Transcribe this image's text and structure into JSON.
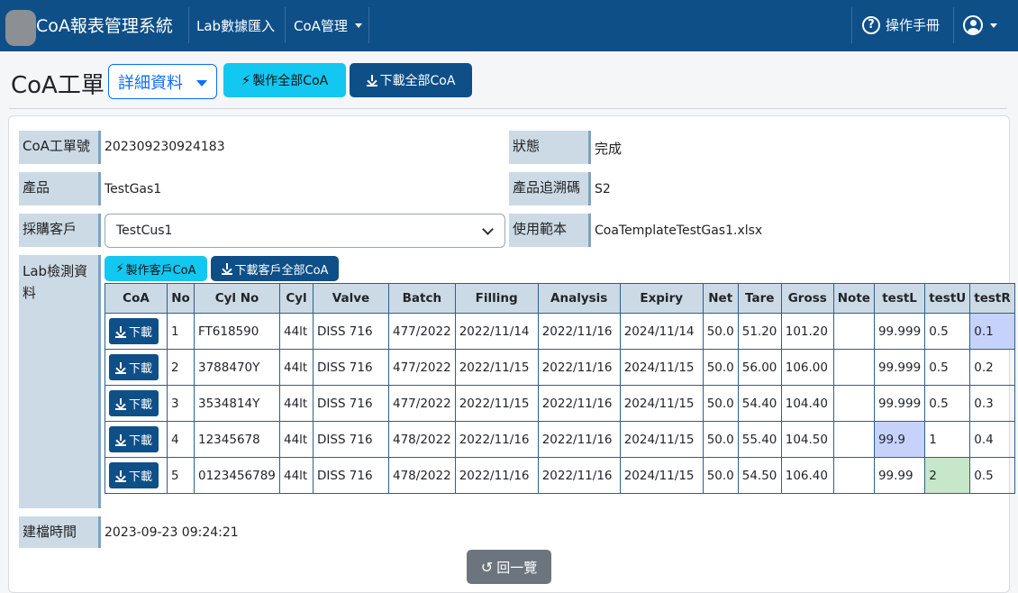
{
  "navbar": {
    "brand": "CoA報表管理系統",
    "lab_import": "Lab數據匯入",
    "coa_manage": "CoA管理",
    "manual": "操作手冊"
  },
  "header": {
    "title": "CoA工單",
    "detail_select": "詳細資料",
    "make_all_label": "製作全部CoA",
    "download_all_label": "下載全部CoA"
  },
  "order": {
    "order_no_label": "CoA工單號",
    "order_no": "202309230924183",
    "status_label": "狀態",
    "status": "完成",
    "product_label": "產品",
    "product": "TestGas1",
    "trace_label": "產品追溯碼",
    "trace": "S2",
    "customer_label": "採購客戶",
    "customer": "TestCus1",
    "template_label": "使用範本",
    "template": "CoaTemplateTestGas1.xlsx",
    "lab_label_1": "Lab檢測資",
    "lab_label_2": "料",
    "make_customer_label": "製作客戶CoA",
    "download_customer_label": "下載客戶全部CoA",
    "created_label": "建檔時間",
    "created": "2023-09-23 09:24:21",
    "back_label": "回一覽"
  },
  "table": {
    "headers": [
      "CoA",
      "No",
      "Cyl No",
      "Cyl",
      "Valve",
      "Batch",
      "Filling",
      "Analysis",
      "Expiry",
      "Net",
      "Tare",
      "Gross",
      "Note",
      "testL",
      "testU",
      "testR"
    ],
    "download_label": "下載",
    "rows": [
      [
        "1",
        "FT618590",
        "44lt",
        "DISS 716",
        "477/2022",
        "2022/11/14",
        "2022/11/16",
        "2024/11/14",
        "50.0",
        "51.20",
        "101.20",
        "",
        "99.999",
        "0.5",
        "0.1"
      ],
      [
        "2",
        "3788470Y",
        "44lt",
        "DISS 716",
        "477/2022",
        "2022/11/15",
        "2022/11/16",
        "2024/11/15",
        "50.0",
        "56.00",
        "106.00",
        "",
        "99.999",
        "0.5",
        "0.2"
      ],
      [
        "3",
        "3534814Y",
        "44lt",
        "DISS 716",
        "477/2022",
        "2022/11/15",
        "2022/11/16",
        "2024/11/15",
        "50.0",
        "54.40",
        "104.40",
        "",
        "99.999",
        "0.5",
        "0.3"
      ],
      [
        "4",
        "12345678",
        "44lt",
        "DISS 716",
        "478/2022",
        "2022/11/16",
        "2022/11/16",
        "2024/11/15",
        "50.0",
        "55.40",
        "104.50",
        "",
        "99.9",
        "1",
        "0.4"
      ],
      [
        "5",
        "0123456789",
        "44lt",
        "DISS 716",
        "478/2022",
        "2022/11/16",
        "2022/11/16",
        "2024/11/15",
        "50.0",
        "54.50",
        "106.40",
        "",
        "99.99",
        "2",
        "0.5"
      ]
    ]
  },
  "colors": {
    "navbar": "#0e4f88",
    "cyan_button": "#12c7f0",
    "highlight_blue": "#c7d2fb",
    "highlight_green": "#c6e7c9"
  }
}
